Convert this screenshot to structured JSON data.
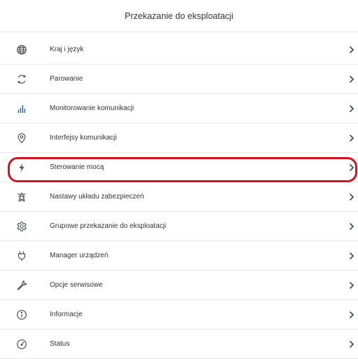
{
  "header": {
    "title": "Przekazanie do eksploatacji"
  },
  "menu": [
    {
      "label": "Kraj i język",
      "icon": "globe-icon"
    },
    {
      "label": "Parowanie",
      "icon": "sync-icon"
    },
    {
      "label": "Monitorowanie komunikacji",
      "icon": "bar-chart-icon"
    },
    {
      "label": "Interfejsy komunikacji",
      "icon": "location-pin-icon"
    },
    {
      "label": "Sterowanie mocą",
      "icon": "lightning-icon"
    },
    {
      "label": "Nastawy układu zabezpieczeń",
      "icon": "power-pylon-icon"
    },
    {
      "label": "Grupowe przekazanie do eksploatacji",
      "icon": "gear-icon"
    },
    {
      "label": "Manager urządzeń",
      "icon": "plug-icon"
    },
    {
      "label": "Opcje serwisowe",
      "icon": "wrench-icon"
    },
    {
      "label": "Informacje",
      "icon": "info-icon"
    },
    {
      "label": "Status",
      "icon": "gauge-icon"
    }
  ],
  "highlight": {
    "color": "#d4141f",
    "item": "Sterowanie mocą"
  }
}
